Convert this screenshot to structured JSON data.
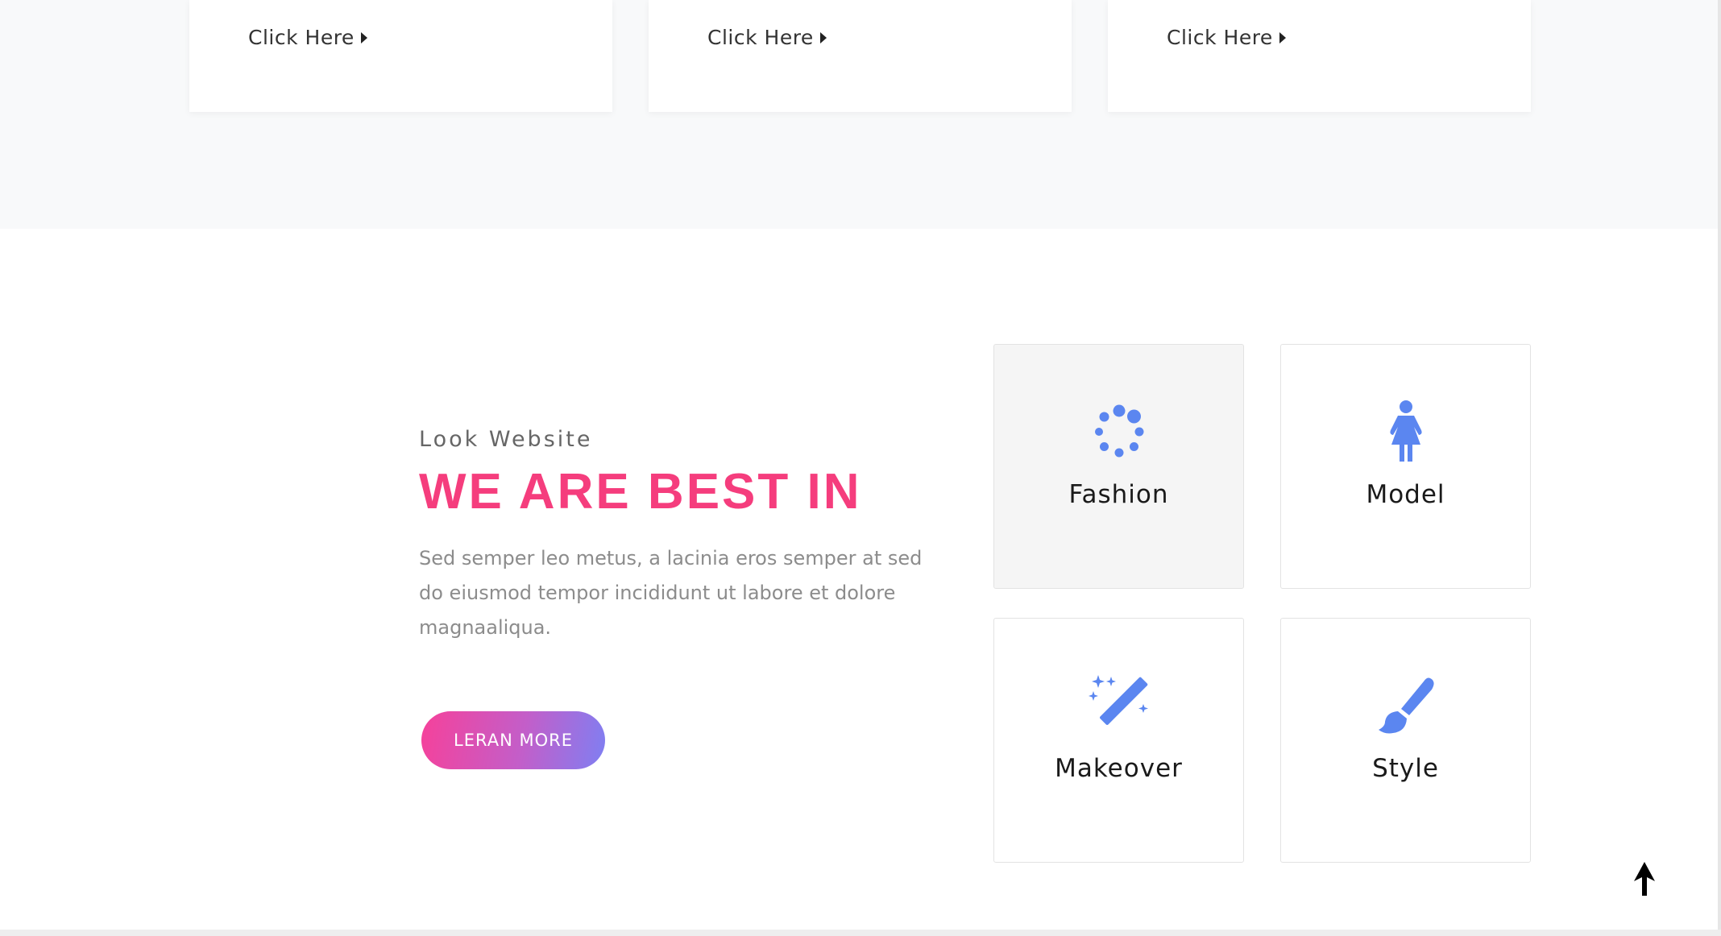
{
  "top_cards": [
    {
      "link_label": "Click Here"
    },
    {
      "link_label": "Click Here"
    },
    {
      "link_label": "Click Here"
    }
  ],
  "intro": {
    "eyebrow": "Look Website",
    "headline": "WE ARE BEST IN",
    "lead": "Sed semper leo metus, a lacinia eros semper at sed do eiusmod tempor incididunt ut labore et dolore magnaaliqua.",
    "cta_label": "LERAN MORE"
  },
  "services": [
    {
      "label": "Fashion",
      "icon": "spinner-dots-icon"
    },
    {
      "label": "Model",
      "icon": "female-figure-icon"
    },
    {
      "label": "Makeover",
      "icon": "magic-wand-icon"
    },
    {
      "label": "Style",
      "icon": "paint-brush-icon"
    }
  ],
  "colors": {
    "accent_pink": "#f53d7d",
    "icon_blue": "#5b86f0",
    "gradient_start": "#f6419a",
    "gradient_end": "#7f7ff2"
  },
  "back_to_top_icon": "arrow-up-icon"
}
